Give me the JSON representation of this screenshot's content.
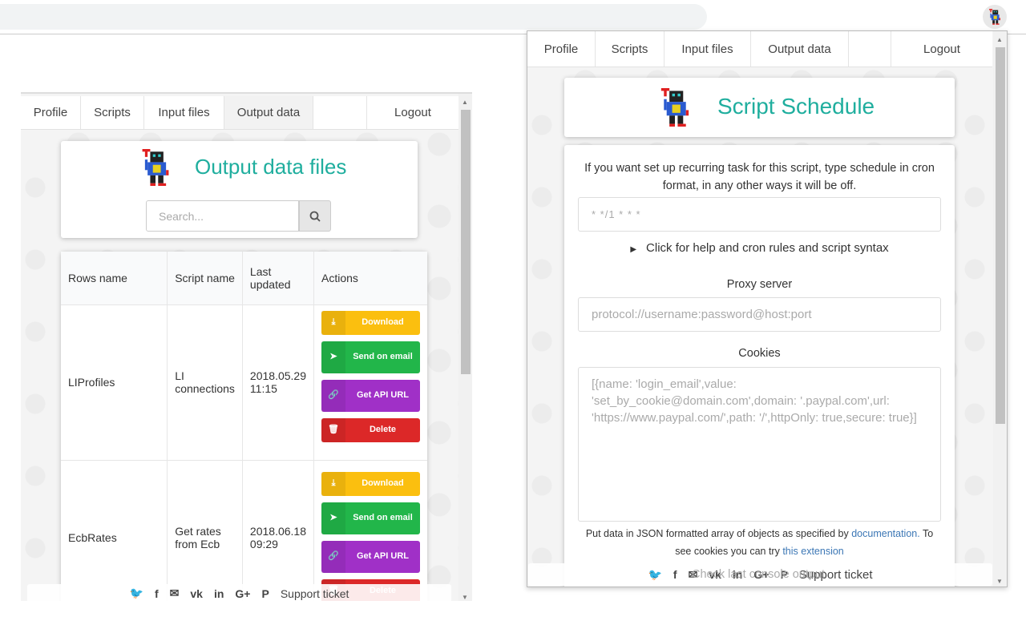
{
  "colors": {
    "teal": "#1fae9e",
    "download": "#fbbf0f",
    "email": "#22b64a",
    "api": "#a030c7",
    "delete": "#dc2828",
    "link": "#3c77b5"
  },
  "nav": {
    "profile": "Profile",
    "scripts": "Scripts",
    "input_files": "Input files",
    "output_data": "Output data",
    "logout": "Logout"
  },
  "left": {
    "title": "Output data files",
    "search_placeholder": "Search...",
    "columns": [
      "Rows name",
      "Script name",
      "Last updated",
      "Actions"
    ],
    "rows": [
      {
        "name": "LIProfiles",
        "script": "LI connections",
        "updated": "2018.05.29 11:15"
      },
      {
        "name": "EcbRates",
        "script": "Get rates from Ecb",
        "updated": "2018.06.18 09:29"
      }
    ],
    "actions": {
      "download": "Download",
      "email": "Send on email",
      "api": "Get API URL",
      "delete": "Delete"
    }
  },
  "right": {
    "title": "Script Schedule",
    "intro": "If you want set up recurring task for this script, type schedule in cron format, in any other ways it will be off.",
    "cron_placeholder": "* */1 * * *",
    "help": "Click for help and cron rules and script syntax",
    "proxy_label": "Proxy server",
    "proxy_placeholder": "protocol://username:password@host:port",
    "cookies_label": "Cookies",
    "cookies_placeholder": "[{name: 'login_email',value: 'set_by_cookie@domain.com',domain: '.paypal.com',url: 'https://www.paypal.com/',path: '/',httpOnly: true,secure: true}]",
    "note_prefix": "Put data in JSON formatted array of objects as specified by ",
    "note_link1": "documentation.",
    "note_mid": " To see cookies you can try ",
    "note_link2": "this extension",
    "hidden_behind_footer": "Check last console output"
  },
  "footer": {
    "icons": [
      "twitter-icon",
      "facebook-icon",
      "envelope-icon",
      "vk-icon",
      "linkedin-icon",
      "google-plus-icon",
      "pinterest-icon"
    ],
    "glyphs": [
      "🐦",
      "f",
      "✉",
      "vk",
      "in",
      "G+",
      "P"
    ],
    "support": "Support ticket"
  }
}
